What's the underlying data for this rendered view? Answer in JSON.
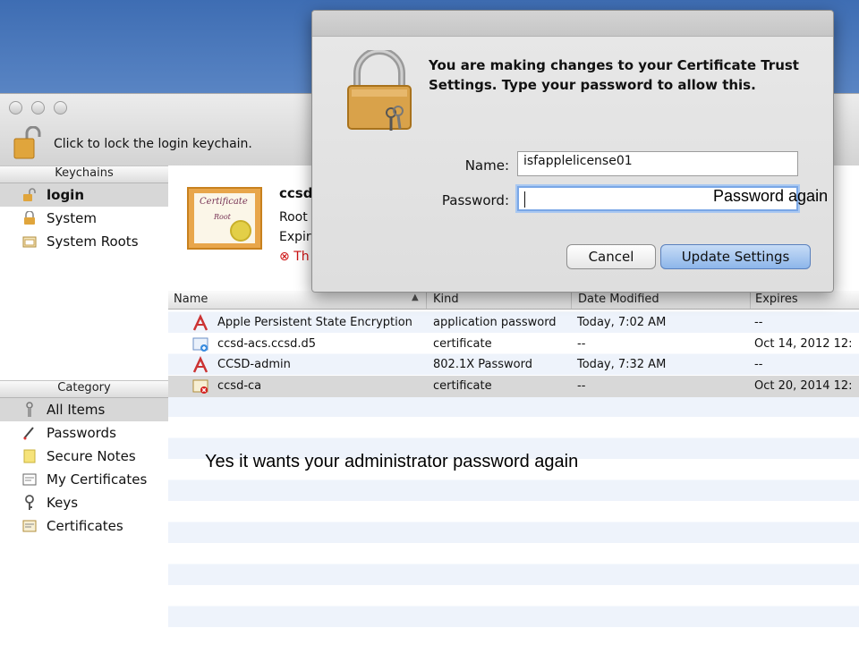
{
  "window": {
    "lock_text": "Click to lock the login keychain."
  },
  "sidebar": {
    "keychains_header": "Keychains",
    "keychains": [
      {
        "label": "login",
        "icon": "unlocked-icon"
      },
      {
        "label": "System",
        "icon": "lock-icon"
      },
      {
        "label": "System Roots",
        "icon": "folder-icon"
      }
    ],
    "category_header": "Category",
    "categories": [
      {
        "label": "All Items",
        "icon": "all-items-icon"
      },
      {
        "label": "Passwords",
        "icon": "pen-icon"
      },
      {
        "label": "Secure Notes",
        "icon": "note-icon"
      },
      {
        "label": "My Certificates",
        "icon": "certificate-icon"
      },
      {
        "label": "Keys",
        "icon": "key-icon"
      },
      {
        "label": "Certificates",
        "icon": "certificate-icon"
      }
    ]
  },
  "detail": {
    "cert_title": "Certificate",
    "cert_sub": "Root",
    "name": "ccsd",
    "line1": "Root",
    "line2": "Expir",
    "error": "Th"
  },
  "table": {
    "columns": [
      "Name",
      "Kind",
      "Date Modified",
      "Expires"
    ],
    "rows": [
      {
        "name": "Apple Persistent State Encryption",
        "kind": "application password",
        "date": "Today, 7:02 AM",
        "expires": "--",
        "icon": "app-password-icon"
      },
      {
        "name": "ccsd-acs.ccsd.d5",
        "kind": "certificate",
        "date": "--",
        "expires": "Oct 14, 2012 12:",
        "icon": "certificate-icon"
      },
      {
        "name": "CCSD-admin",
        "kind": "802.1X Password",
        "date": "Today, 7:32 AM",
        "expires": "--",
        "icon": "app-password-icon"
      },
      {
        "name": "ccsd-ca",
        "kind": "certificate",
        "date": "--",
        "expires": "Oct 20, 2014 12:",
        "icon": "certificate-error-icon"
      }
    ]
  },
  "caption": "Yes it wants your administrator password again",
  "dialog": {
    "message": "You are making changes to your Certificate Trust Settings. Type your password to allow this.",
    "name_label": "Name:",
    "name_value": "isfapplelicense01",
    "password_label": "Password:",
    "password_note": "Password again",
    "cancel_label": "Cancel",
    "update_label": "Update Settings"
  }
}
